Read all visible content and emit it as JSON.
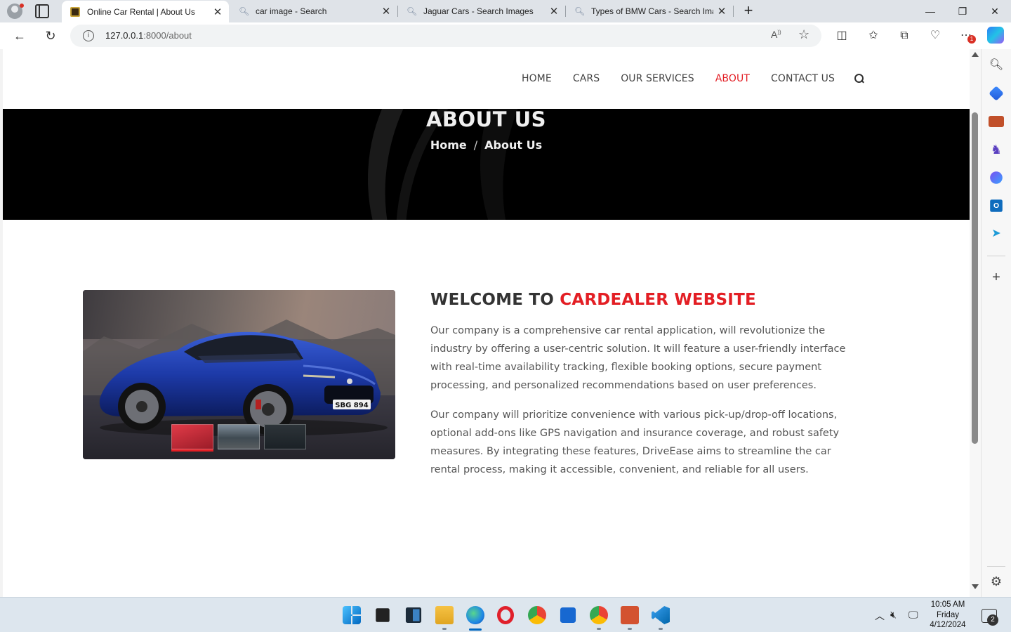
{
  "browser": {
    "tabs": [
      {
        "title": "Online Car Rental | About Us",
        "favicon": "site-logo-icon"
      },
      {
        "title": "car image - Search",
        "favicon": "search-icon"
      },
      {
        "title": "Jaguar Cars - Search Images",
        "favicon": "search-icon"
      },
      {
        "title": "Types of BMW Cars - Search Images",
        "favicon": "search-icon"
      }
    ],
    "url_host": "127.0.0.1",
    "url_rest": ":8000/about",
    "extension_badge": "1"
  },
  "site": {
    "nav": [
      "HOME",
      "CARS",
      "OUR SERVICES",
      "ABOUT",
      "CONTACT US"
    ],
    "active_nav": "ABOUT",
    "accent_color": "#e31e24",
    "hero": {
      "title": "ABOUT US",
      "crumb_home": "Home",
      "crumb_sep": "/",
      "crumb_current": "About Us"
    },
    "about": {
      "heading_prefix": "WELCOME TO",
      "heading_accent": "CARDEALER WEBSITE",
      "paragraph1": "Our company is a comprehensive car rental application, will revolutionize the industry by offering a user-centric solution. It will feature a user-friendly interface with real-time availability tracking, flexible booking options, secure payment processing, and personalized recommendations based on user preferences.",
      "paragraph2": "Our company will prioritize convenience with various pick-up/drop-off locations, optional add-ons like GPS navigation and insurance coverage, and robust safety measures. By integrating these features, DriveEase aims to streamline the car rental process, making it accessible, convenient, and reliable for all users.",
      "car_plate": "SBG 894"
    }
  },
  "taskbar": {
    "time": "10:05 AM",
    "day": "Friday",
    "date": "4/12/2024",
    "notifications": "2"
  }
}
